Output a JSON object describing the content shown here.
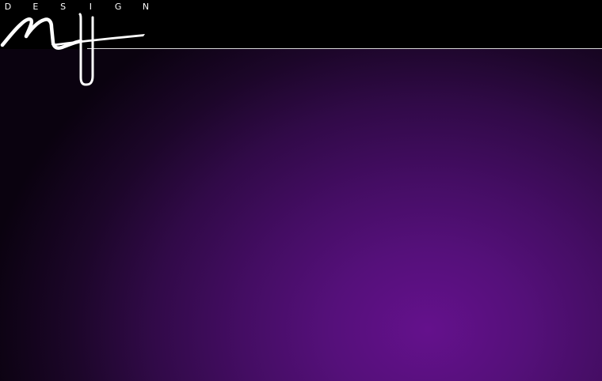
{
  "brand": {
    "letters": [
      "D",
      "E",
      "S",
      "I",
      "G",
      "N"
    ]
  },
  "colors": {
    "background": "#000000",
    "accent": "#64118c",
    "rule": "#d8d8d8",
    "logo": "#ffffff"
  }
}
